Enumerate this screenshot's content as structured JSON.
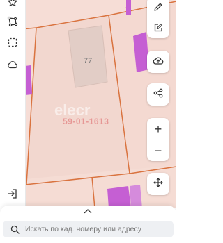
{
  "left_toolbar": {
    "items": [
      {
        "name": "star-icon"
      },
      {
        "name": "polygon-tool-icon"
      },
      {
        "name": "selection-rectangle-icon"
      },
      {
        "name": "cloud-icon"
      },
      {
        "name": "login-icon"
      }
    ]
  },
  "right_controls": {
    "edit_icons": [
      "pencil-icon",
      "edit-box-icon"
    ],
    "upload_icon": "cloud-upload-icon",
    "share_icon": "share-icon",
    "zoom_in_label": "+",
    "zoom_out_label": "−",
    "move_icon": "move-arrows-icon"
  },
  "map": {
    "parcel_number": "77",
    "cadastral_label": "59-01-1613",
    "watermark": "elecr",
    "colors": {
      "background": "#f6ddd6",
      "parcel_fill": "#efd6cf",
      "boundary": "#d9733f",
      "building": "#e0cbc4",
      "highlight": "#c55fd3"
    }
  },
  "bottom_panel": {
    "search_placeholder": "Искать по кад. номеру или адресу"
  }
}
